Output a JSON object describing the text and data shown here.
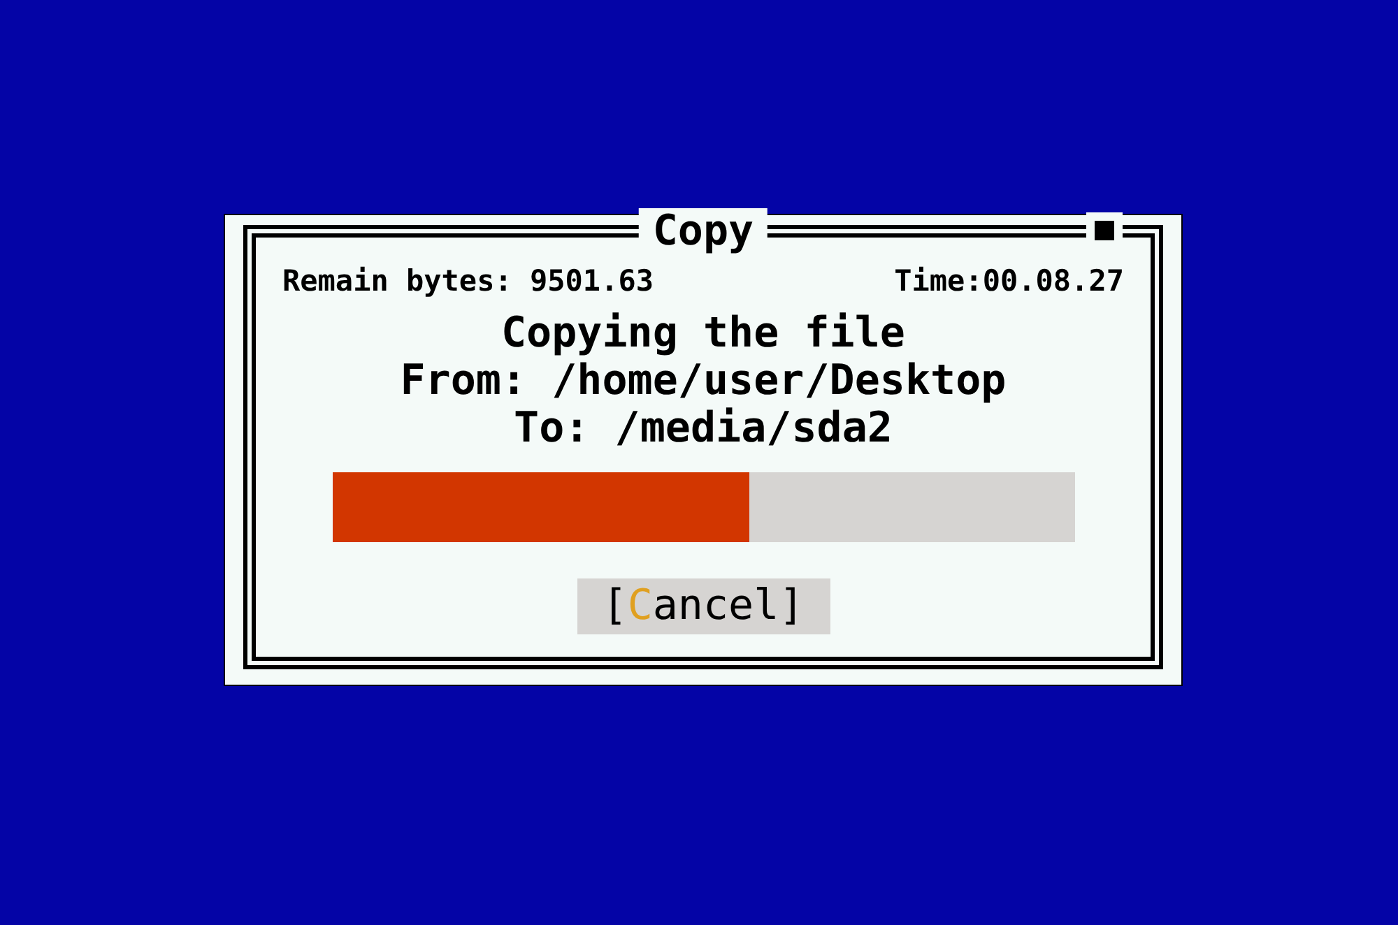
{
  "dialog": {
    "title": "Copy",
    "remain_bytes": "Remain bytes: 9501.63",
    "time": "Time:00.08.27",
    "message": [
      "Copying the file",
      "From: /home/user/Desktop",
      "To: /media/sda2"
    ],
    "progress": {
      "level": 0.563
    },
    "cancel_button": {
      "open": "[",
      "hotkey": "C",
      "rest": "ancel]"
    }
  }
}
